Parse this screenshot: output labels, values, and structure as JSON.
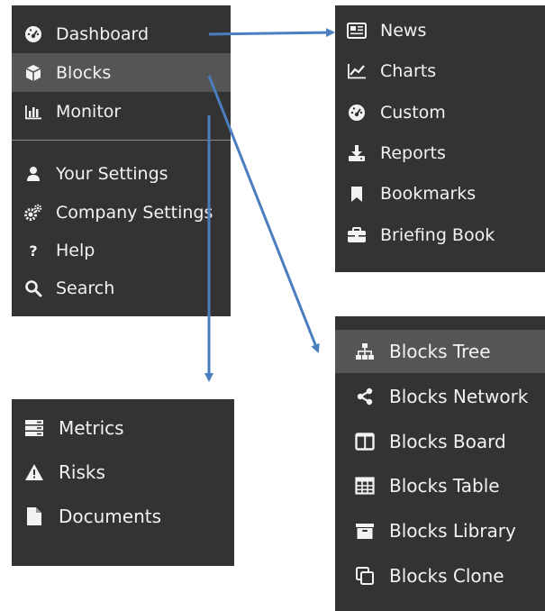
{
  "main_menu": {
    "items": [
      {
        "label": "Dashboard",
        "icon": "dashboard-icon"
      },
      {
        "label": "Blocks",
        "icon": "cube-icon"
      },
      {
        "label": "Monitor",
        "icon": "bar-chart-icon"
      },
      {
        "label": "Your Settings",
        "icon": "user-icon"
      },
      {
        "label": "Company Settings",
        "icon": "gears-icon"
      },
      {
        "label": "Help",
        "icon": "question-icon"
      },
      {
        "label": "Search",
        "icon": "search-icon"
      }
    ],
    "active": "Blocks"
  },
  "dashboard_submenu": {
    "items": [
      {
        "label": "News",
        "icon": "newspaper-icon"
      },
      {
        "label": "Charts",
        "icon": "line-chart-icon"
      },
      {
        "label": "Custom",
        "icon": "dashboard-icon"
      },
      {
        "label": "Reports",
        "icon": "download-icon"
      },
      {
        "label": "Bookmarks",
        "icon": "bookmark-icon"
      },
      {
        "label": "Briefing Book",
        "icon": "briefcase-icon"
      }
    ]
  },
  "monitor_submenu": {
    "items": [
      {
        "label": "Metrics",
        "icon": "server-icon"
      },
      {
        "label": "Risks",
        "icon": "warning-icon"
      },
      {
        "label": "Documents",
        "icon": "file-icon"
      }
    ]
  },
  "blocks_submenu": {
    "items": [
      {
        "label": "Blocks Tree",
        "icon": "sitemap-icon"
      },
      {
        "label": "Blocks Network",
        "icon": "share-icon"
      },
      {
        "label": "Blocks Board",
        "icon": "columns-icon"
      },
      {
        "label": "Blocks Table",
        "icon": "table-icon"
      },
      {
        "label": "Blocks Library",
        "icon": "archive-icon"
      },
      {
        "label": "Blocks Clone",
        "icon": "clone-icon"
      }
    ],
    "active": "Blocks Tree"
  },
  "colors": {
    "panel_bg": "#333333",
    "active_bg": "#555555",
    "text": "#f2f2f2",
    "arrow": "#4a7ebf"
  }
}
